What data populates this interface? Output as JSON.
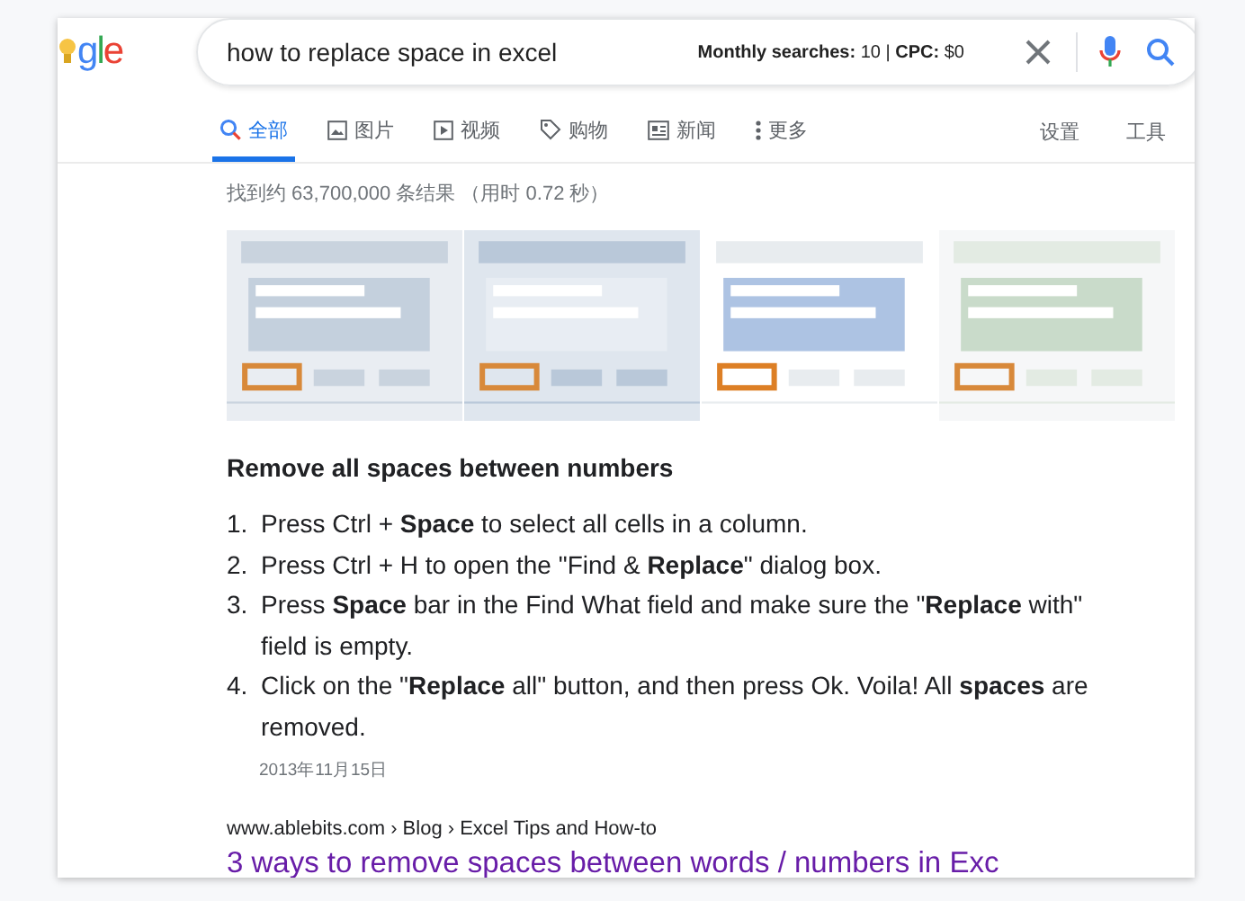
{
  "logo": {
    "text": "gle"
  },
  "search": {
    "value": "how to replace space in excel",
    "stats": "**Monthly searches:** 10 | **CPC:** $0"
  },
  "tabs": [
    {
      "label": "全部",
      "selected": true
    },
    {
      "label": "图片",
      "selected": false
    },
    {
      "label": "视频",
      "selected": false
    },
    {
      "label": "购物",
      "selected": false
    },
    {
      "label": "新闻",
      "selected": false
    },
    {
      "label": "更多",
      "selected": false
    }
  ],
  "tools": [
    "设置",
    "工具"
  ],
  "result_stats": "找到约 63,700,000 条结果 （用时 0.72 秒）",
  "snippet": {
    "title": "Remove all spaces between numbers",
    "steps": [
      {
        "number": "1.",
        "text": "Press Ctrl + **Space** to select all cells in a column."
      },
      {
        "number": "2.",
        "text": "Press Ctrl + H to open the \"Find & **Replace**\" dialog box."
      },
      {
        "number": "3.",
        "text": "Press **Space** bar in the Find What field and make sure the \"**Replace** with\" field is empty."
      },
      {
        "number": "4.",
        "text": "Click on the \"**Replace** all\" button, and then press Ok. Voila! All **spaces** are removed."
      }
    ],
    "date": "2013年11月15日"
  },
  "result": {
    "breadcrumb": "www.ablebits.com › Blog › Excel Tips and How-to",
    "title": "3 ways to remove spaces between words / numbers in Exc"
  }
}
